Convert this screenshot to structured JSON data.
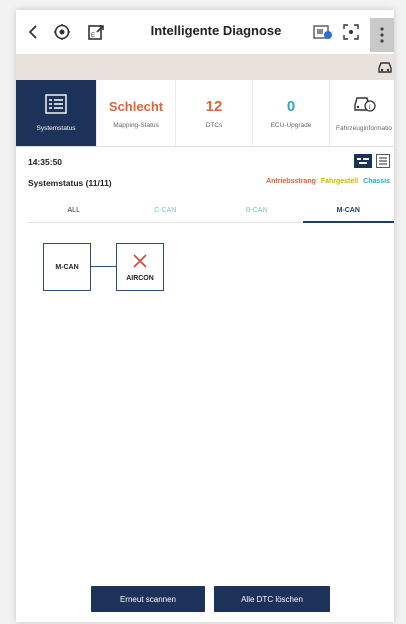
{
  "header": {
    "title": "Intelligente Diagnose",
    "icons": [
      "back-icon",
      "diagnose-settings-icon",
      "export-icon",
      "vci-icon",
      "screenshot-icon",
      "more-icon"
    ]
  },
  "status": {
    "system_label": "Systemstatus",
    "mapping_value": "Schlecht",
    "mapping_label": "Mapping-Status",
    "dtc_value": "12",
    "dtc_label": "DTCs",
    "ecu_value": "0",
    "ecu_label": "ECU-Upgrade",
    "vehicle_label": "Fahrzeuginformatio"
  },
  "info": {
    "time": "14:35:50",
    "system_status": "Systemstatus (11/11)",
    "categories": [
      {
        "label": "Antriebsstrang",
        "color": "#e0623a"
      },
      {
        "label": "Fahrgestell",
        "color": "#c8b800"
      },
      {
        "label": "Chassis",
        "color": "#2aa8c8"
      }
    ]
  },
  "tabs": [
    "ALL",
    "C-CAN",
    "B-CAN",
    "M-CAN"
  ],
  "active_tab": "M-CAN",
  "topology": {
    "bus": "M-CAN",
    "ecu": "AIRCON"
  },
  "buttons": {
    "rescan": "Erneut scannen",
    "clear_dtc": "Alle DTC löschen"
  },
  "colors": {
    "accent": "#1c3258",
    "bad": "#e0623a",
    "ecu_value": "#2aa8c8",
    "error": "#d9453a"
  }
}
